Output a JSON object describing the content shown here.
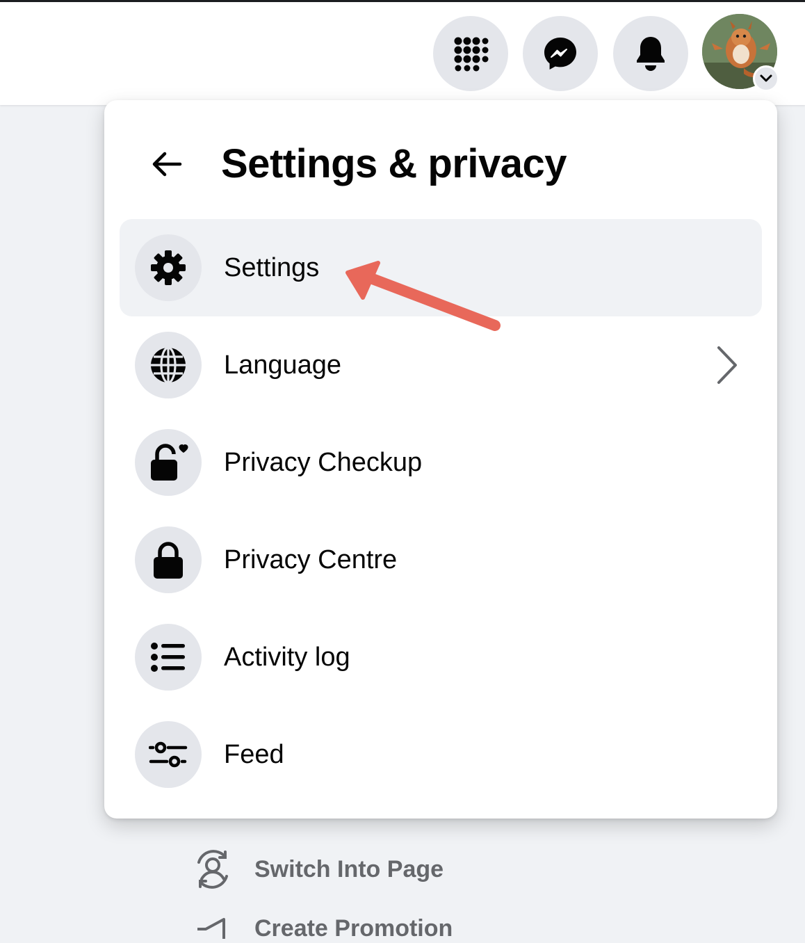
{
  "topbar": {
    "buttons": [
      {
        "icon": "menu-grid-icon"
      },
      {
        "icon": "messenger-icon"
      },
      {
        "icon": "bell-icon"
      }
    ],
    "avatar_badge_icon": "chevron-down-icon"
  },
  "panel": {
    "back_icon": "arrow-left-icon",
    "title": "Settings & privacy",
    "items": [
      {
        "label": "Settings",
        "icon": "gear-icon",
        "highlighted": true
      },
      {
        "label": "Language",
        "icon": "globe-icon",
        "has_submenu": true
      },
      {
        "label": "Privacy Checkup",
        "icon": "lock-heart-icon"
      },
      {
        "label": "Privacy Centre",
        "icon": "lock-icon"
      },
      {
        "label": "Activity log",
        "icon": "list-icon"
      },
      {
        "label": "Feed",
        "icon": "sliders-icon"
      }
    ]
  },
  "background_menu": {
    "items": [
      {
        "label": "Switch Into Page",
        "icon": "switch-profile-icon"
      },
      {
        "label": "Create Promotion",
        "icon": "megaphone-icon"
      }
    ]
  },
  "annotation": {
    "arrow_color": "#e8685a",
    "points_to": "Settings"
  },
  "colors": {
    "icon_bg": "#e4e6eb",
    "highlight_bg": "#f0f2f5",
    "secondary_text": "#65676b"
  }
}
